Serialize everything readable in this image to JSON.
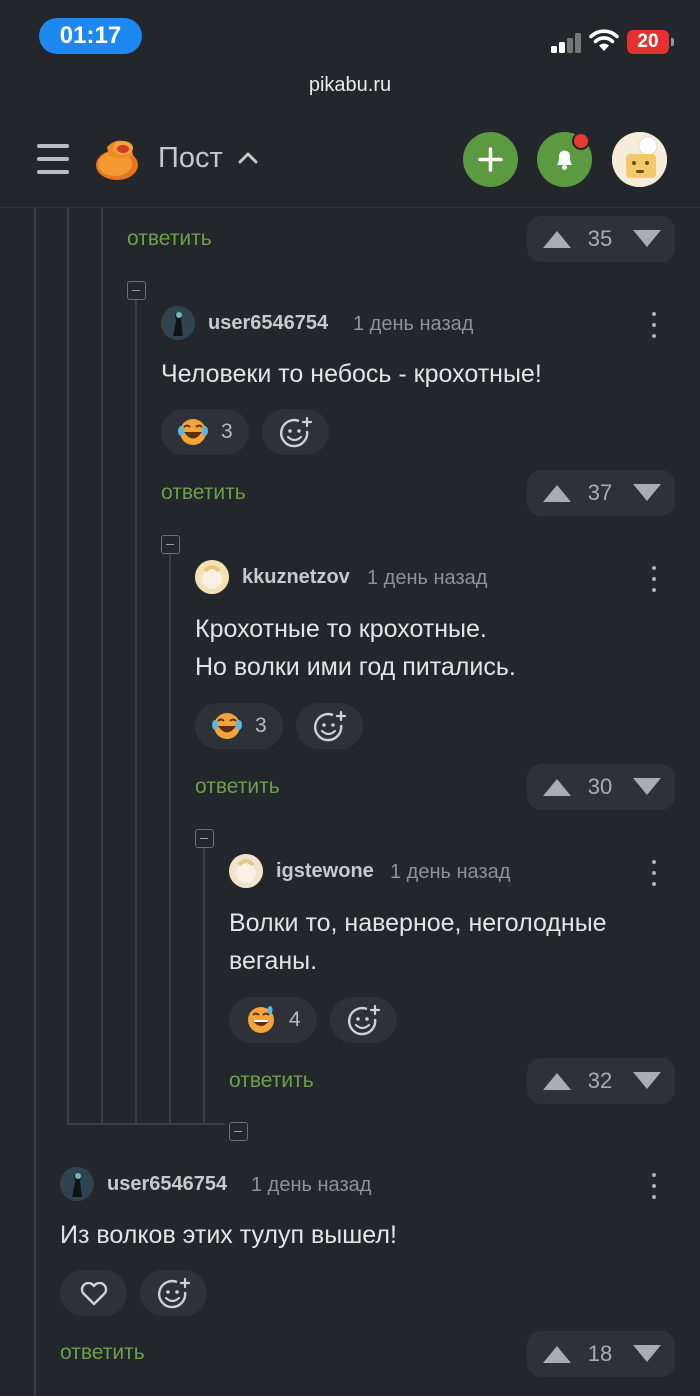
{
  "status_bar": {
    "time": "01:17",
    "battery": "20"
  },
  "browser": {
    "url": "pikabu.ru"
  },
  "header": {
    "title": "Пост"
  },
  "thread": {
    "reply_label": "ответить",
    "top_votes": "35",
    "comments": [
      {
        "username": "user6546754",
        "time": "1 день назад",
        "text_lines": [
          "Человеки то небось - крохотные!"
        ],
        "reaction_count": "3",
        "votes": "37"
      },
      {
        "username": "kkuznetzov",
        "time": "1 день назад",
        "text_lines": [
          "Крохотные то крохотные.",
          "Но волки ими год питались."
        ],
        "reaction_count": "3",
        "votes": "30"
      },
      {
        "username": "igstewone",
        "time": "1 день назад",
        "text_lines": [
          "Волки то, наверное, неголодные",
          "веганы."
        ],
        "reaction_count": "4",
        "votes": "32"
      },
      {
        "username": "user6546754",
        "time": "1 день назад",
        "text_lines": [
          "Из волков этих тулуп вышел!"
        ],
        "votes": "18"
      }
    ]
  },
  "colors": {
    "background": "#23262b",
    "accent_green": "#5b9a40",
    "reply_green": "#6aa14a",
    "notification": "#e53b2e",
    "time_pill": "#1e87f0"
  }
}
